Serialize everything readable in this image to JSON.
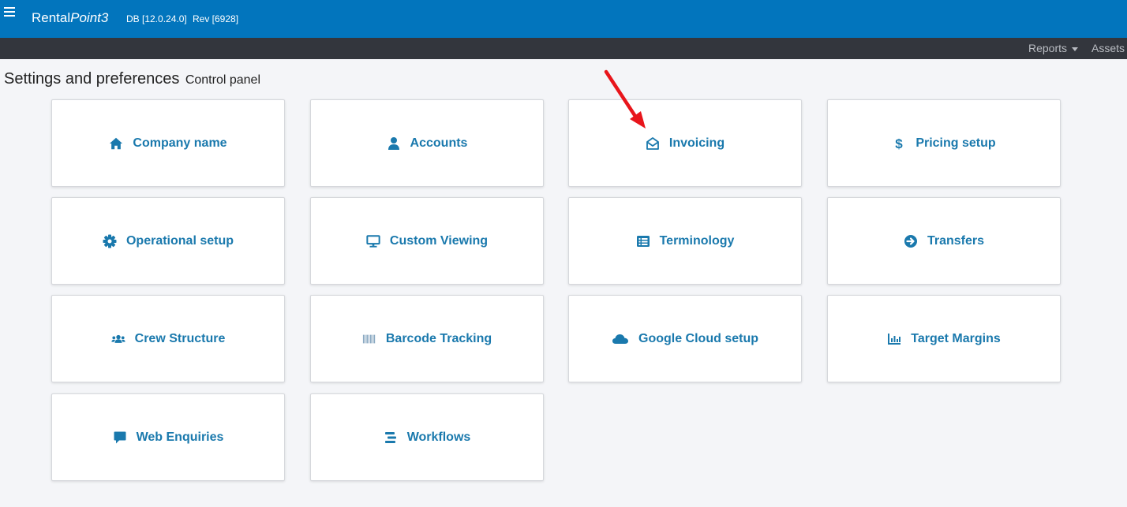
{
  "header": {
    "brand_regular": "Rental",
    "brand_italic": "Point3",
    "db_version": "DB [12.0.24.0]",
    "revision": "Rev [6928]",
    "menu_icon": "hamburger-icon"
  },
  "subnav": {
    "reports_label": "Reports",
    "assets_label": "Assets"
  },
  "page": {
    "title": "Settings and preferences",
    "subtitle": "Control panel"
  },
  "tiles": [
    {
      "label": "Company name",
      "icon": "home-icon"
    },
    {
      "label": "Accounts",
      "icon": "user-icon"
    },
    {
      "label": "Invoicing",
      "icon": "envelope-open-icon"
    },
    {
      "label": "Pricing setup",
      "icon": "dollar-icon"
    },
    {
      "label": "Operational setup",
      "icon": "gear-icon"
    },
    {
      "label": "Custom Viewing",
      "icon": "monitor-icon"
    },
    {
      "label": "Terminology",
      "icon": "list-alt-icon"
    },
    {
      "label": "Transfers",
      "icon": "arrow-circle-right-icon"
    },
    {
      "label": "Crew Structure",
      "icon": "users-icon"
    },
    {
      "label": "Barcode Tracking",
      "icon": "barcode-icon"
    },
    {
      "label": "Google Cloud setup",
      "icon": "cloud-icon"
    },
    {
      "label": "Target Margins",
      "icon": "bar-chart-icon"
    },
    {
      "label": "Web Enquiries",
      "icon": "comment-icon"
    },
    {
      "label": "Workflows",
      "icon": "stream-icon"
    }
  ],
  "colors": {
    "header_bg": "#0275bd",
    "subnav_bg": "#33363d",
    "tile_text": "#1a79ad",
    "arrow": "#e8151b"
  }
}
